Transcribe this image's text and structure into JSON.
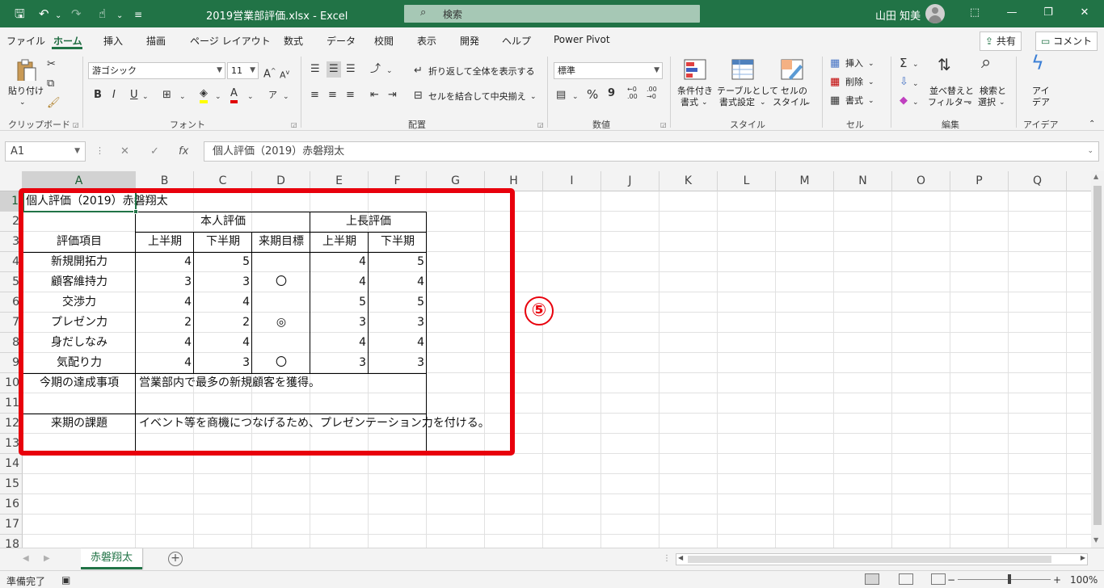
{
  "titlebar": {
    "filename": "2019営業部評価.xlsx",
    "separator": " - ",
    "app": "Excel",
    "search_placeholder": "検索",
    "user_name": "山田 知美",
    "qa_save": "🖫",
    "qa_undo": "↶",
    "qa_redo": "↷",
    "qa_touch": "☝",
    "qa_more": "⌄",
    "qa_customize": "≡",
    "min_icon": "—",
    "restore_icon": "❐",
    "close_icon": "✕",
    "ribbon_display_icon": "⬚"
  },
  "menu": {
    "tabs": [
      "ファイル",
      "ホーム",
      "挿入",
      "描画",
      "ページ レイアウト",
      "数式",
      "データ",
      "校閲",
      "表示",
      "開発",
      "ヘルプ",
      "Power Pivot"
    ],
    "active": "ホーム",
    "share_label": "共有",
    "comment_label": "コメント"
  },
  "ribbon": {
    "clipboard": {
      "paste": "貼り付け",
      "label": "クリップボード"
    },
    "font": {
      "name": "游ゴシック",
      "size": "11",
      "bold": "B",
      "italic": "I",
      "underline": "U",
      "label": "フォント",
      "grow": "A",
      "shrink": "A",
      "phonetic": "ア"
    },
    "alignment": {
      "wrap": "折り返して全体を表示する",
      "merge": "セルを結合して中央揃え",
      "label": "配置"
    },
    "number": {
      "format": "標準",
      "percent": "%",
      "comma": "9",
      "inc": "←0 .00",
      "dec": ".00 →0",
      "label": "数値"
    },
    "styles": {
      "conditional": [
        "条件付き",
        "書式"
      ],
      "table": [
        "テーブルとして",
        "書式設定"
      ],
      "cellstyle": [
        "セルの",
        "スタイル"
      ],
      "label": "スタイル"
    },
    "cells": {
      "insert": "挿入",
      "delete": "削除",
      "format": "書式",
      "label": "セル"
    },
    "editing": {
      "sum": "Σ",
      "sort": [
        "並べ替えと",
        "フィルター"
      ],
      "find": [
        "検索と",
        "選択"
      ],
      "label": "編集"
    },
    "ideas": {
      "btn": [
        "アイ",
        "デア"
      ],
      "label": "アイデア"
    }
  },
  "formula_bar": {
    "name_box": "A1",
    "cancel": "✕",
    "enter": "✓",
    "fx": "fx",
    "content": "個人評価（2019）赤磐翔太"
  },
  "grid": {
    "columns": [
      "A",
      "B",
      "C",
      "D",
      "E",
      "F",
      "G",
      "H",
      "I",
      "J",
      "K",
      "L",
      "M",
      "N",
      "O",
      "P",
      "Q"
    ],
    "rows": [
      "1",
      "2",
      "3",
      "4",
      "5",
      "6",
      "7",
      "8",
      "9",
      "10",
      "11",
      "12",
      "13",
      "14",
      "15",
      "16",
      "17",
      "18"
    ],
    "cells": {
      "A1": "個人評価（2019）赤磐翔太",
      "B2": "本人評価",
      "E2": "上長評価",
      "A3": "評価項目",
      "B3": "上半期",
      "C3": "下半期",
      "D3": "来期目標",
      "E3": "上半期",
      "F3": "下半期",
      "A4": "新規開拓力",
      "B4": "4",
      "C4": "5",
      "E4": "4",
      "F4": "5",
      "A5": "顧客維持力",
      "B5": "3",
      "C5": "3",
      "D5": "〇",
      "E5": "4",
      "F5": "4",
      "A6": "交渉力",
      "B6": "4",
      "C6": "4",
      "E6": "5",
      "F6": "5",
      "A7": "プレゼン力",
      "B7": "2",
      "C7": "2",
      "D7": "◎",
      "E7": "3",
      "F7": "3",
      "A8": "身だしなみ",
      "B8": "4",
      "C8": "4",
      "E8": "4",
      "F8": "4",
      "A9": "気配り力",
      "B9": "4",
      "C9": "3",
      "D9": "〇",
      "E9": "3",
      "F9": "3",
      "A10": "今期の達成事項",
      "B10": "営業部内で最多の新規顧客を獲得。",
      "A12": "来期の課題",
      "B12": "イベント等を商機につなげるため、プレゼンテーション力を付ける。"
    }
  },
  "annotation": {
    "badge": "⑤",
    "color": "#e8000c"
  },
  "sheets": {
    "tabs": [
      "赤磐翔太"
    ],
    "active": "赤磐翔太",
    "add": "+"
  },
  "status": {
    "ready": "準備完了",
    "zoom": "100%",
    "zoom_minus": "−",
    "zoom_plus": "+"
  },
  "colors": {
    "accent": "#217346",
    "red_frame": "#e8000c"
  }
}
